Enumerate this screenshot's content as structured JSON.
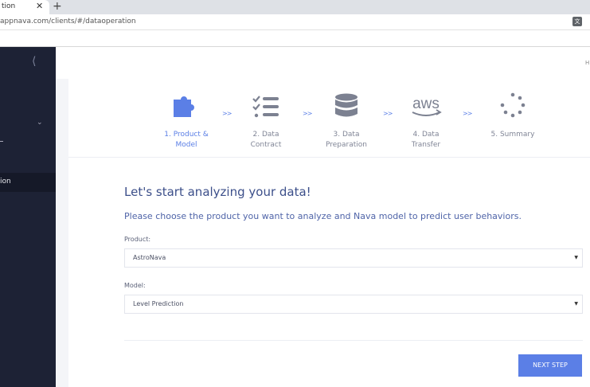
{
  "browser": {
    "tab_title": "tion",
    "url": "appnava.com/clients/#/dataoperation"
  },
  "sidebar": {
    "active_item_label": "ion"
  },
  "header": {
    "right_text": "H"
  },
  "stepper": {
    "separator": ">>",
    "steps": [
      {
        "label_line1": "1. Product &",
        "label_line2": "Model",
        "active": true,
        "icon": "puzzle-icon"
      },
      {
        "label_line1": "2. Data",
        "label_line2": "Contract",
        "active": false,
        "icon": "checklist-icon"
      },
      {
        "label_line1": "3. Data",
        "label_line2": "Preparation",
        "active": false,
        "icon": "database-icon"
      },
      {
        "label_line1": "4. Data",
        "label_line2": "Transfer",
        "active": false,
        "icon": "aws-icon"
      },
      {
        "label_line1": "5. Summary",
        "label_line2": "",
        "active": false,
        "icon": "loading-dots-icon"
      }
    ],
    "aws_text": "aws"
  },
  "form": {
    "heading": "Let's start analyzing your data!",
    "subheading": "Please choose the product you want to analyze and Nava model to predict user behaviors.",
    "product_label": "Product:",
    "product_value": "AstroNava",
    "model_label": "Model:",
    "model_value": "Level Prediction",
    "next_button": "NEXT STEP"
  },
  "colors": {
    "accent": "#5b7fe6",
    "icon_gray": "#7c8191",
    "sidebar_bg": "#1d2235"
  }
}
